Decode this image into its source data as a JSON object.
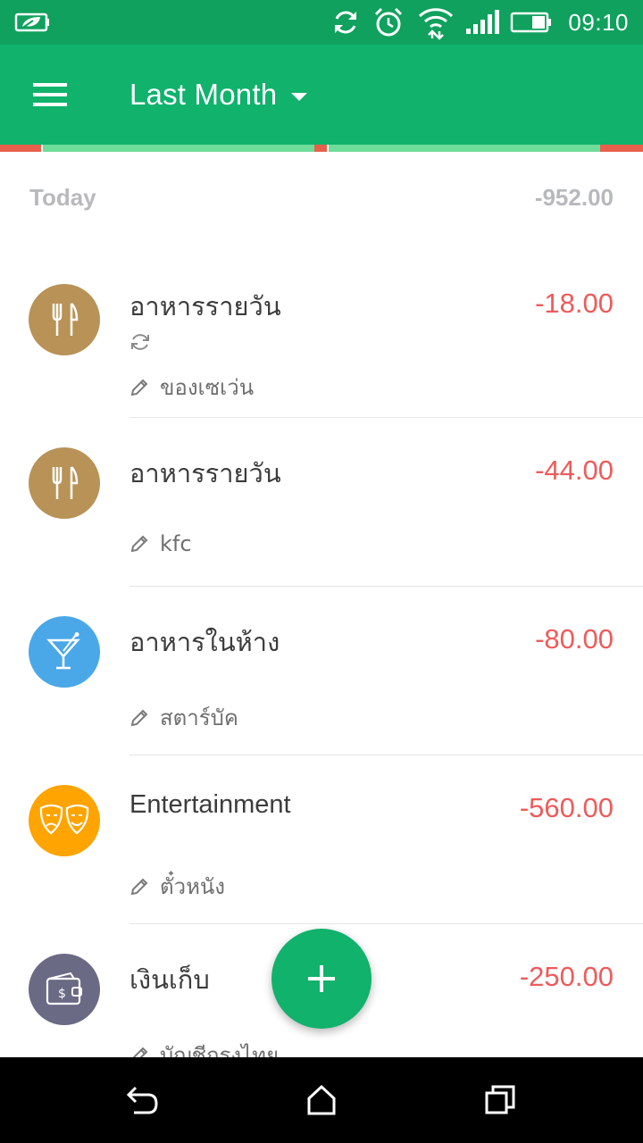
{
  "status_bar": {
    "time": "09:10",
    "icons": [
      "leaf-battery-saver-icon",
      "sync-icon",
      "alarm-icon",
      "wifi-icon",
      "signal-icon",
      "battery-icon"
    ]
  },
  "app_bar": {
    "menu_icon": "hamburger-menu-icon",
    "title": "Last Month",
    "dropdown_icon": "caret-down-icon"
  },
  "colors": {
    "primary": "#10b26c",
    "status_bar": "#0fa15d",
    "expense": "#ee5b5b",
    "muted": "#b7b9bc",
    "strip_red": "#e8604c",
    "strip_green": "#6fdc9a"
  },
  "day": {
    "label": "Today",
    "total": "-952.00"
  },
  "transactions": [
    {
      "category": "อาหารรายวัน",
      "note": "ของเซเว่น",
      "amount": "-18.00",
      "icon": "fork-knife-icon",
      "icon_color": "#b89257",
      "recurring": true
    },
    {
      "category": "อาหารรายวัน",
      "note": "kfc",
      "amount": "-44.00",
      "icon": "fork-knife-icon",
      "icon_color": "#b89257",
      "recurring": false
    },
    {
      "category": "อาหารในห้าง",
      "note": "สตาร์บัค",
      "amount": "-80.00",
      "icon": "cocktail-icon",
      "icon_color": "#4aa8e8",
      "recurring": false
    },
    {
      "category": "Entertainment",
      "note": "ตั๋วหนัง",
      "amount": "-560.00",
      "icon": "theater-masks-icon",
      "icon_color": "#ffa400",
      "recurring": false
    },
    {
      "category": "เงินเก็บ",
      "note": "บัญชีกรุงไทย",
      "amount": "-250.00",
      "icon": "wallet-icon",
      "icon_color": "#6a6a85",
      "recurring": false
    }
  ],
  "fab": {
    "icon": "plus-icon"
  },
  "nav_bar": {
    "icons": [
      "back-icon",
      "home-icon",
      "recents-icon"
    ]
  }
}
